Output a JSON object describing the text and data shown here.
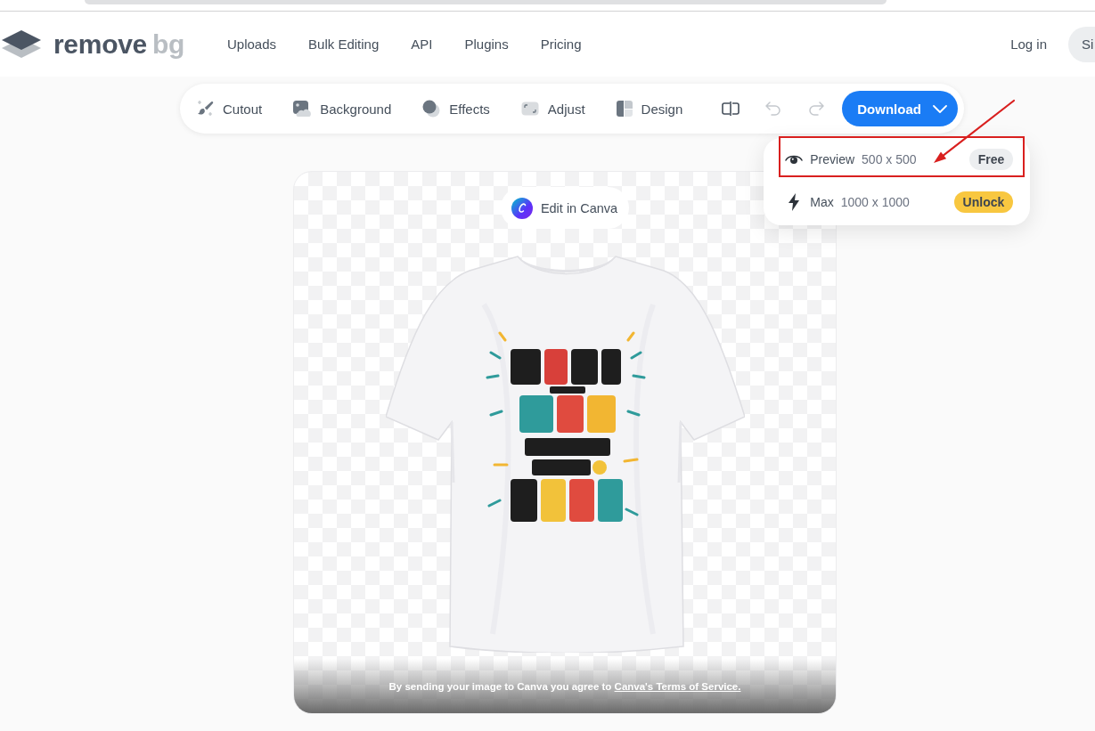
{
  "header": {
    "logo": {
      "text": "remove",
      "accent": "bg"
    },
    "nav": [
      "Uploads",
      "Bulk Editing",
      "API",
      "Plugins",
      "Pricing"
    ],
    "login": "Log in",
    "signup": "Si"
  },
  "toolbar": {
    "tools": [
      {
        "kind": "cutout",
        "label": "Cutout"
      },
      {
        "kind": "background",
        "label": "Background"
      },
      {
        "kind": "effects",
        "label": "Effects"
      },
      {
        "kind": "adjust",
        "label": "Adjust"
      },
      {
        "kind": "design",
        "label": "Design"
      }
    ],
    "actions": [
      {
        "kind": "compare",
        "disabled": false
      },
      {
        "kind": "undo",
        "disabled": true
      },
      {
        "kind": "redo",
        "disabled": true
      }
    ],
    "download": {
      "label": "Download",
      "expanded": true
    }
  },
  "download_menu": {
    "options": [
      {
        "kind": "preview",
        "name": "Preview",
        "size": "500 x 500",
        "badge": {
          "label": "Free",
          "color": "#eceef0"
        },
        "highlighted": true
      },
      {
        "kind": "max",
        "name": "Max",
        "size": "1000 x 1000",
        "badge": {
          "label": "Unlock",
          "color": "#f8c740"
        },
        "highlighted": false
      }
    ]
  },
  "canvas": {
    "edit_button": "Edit in Canva",
    "consent": {
      "text": "By sending your image to Canva you agree to ",
      "link": "Canva's Terms of Service."
    }
  }
}
